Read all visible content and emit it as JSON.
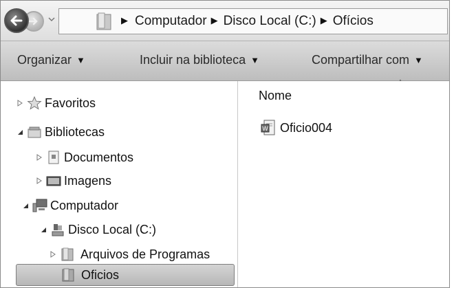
{
  "address_bar": {
    "breadcrumbs": [
      "Computador",
      "Disco Local (C:)",
      "Ofícios"
    ]
  },
  "toolbar": {
    "organize_label": "Organizar",
    "include_label": "Incluir na biblioteca",
    "share_label": "Compartilhar com"
  },
  "nav_tree": {
    "favorites": "Favoritos",
    "libraries": "Bibliotecas",
    "documents": "Documentos",
    "images": "Imagens",
    "computer": "Computador",
    "local_disk": "Disco Local (C:)",
    "program_files": "Arquivos de Programas",
    "oficios": "Oficios"
  },
  "content": {
    "column_name": "Nome",
    "files": [
      {
        "name": "Oficio004",
        "icon": "word-document-icon"
      }
    ]
  },
  "icons": {
    "back": "back-arrow-icon",
    "forward": "forward-arrow-icon",
    "favorites": "star-icon",
    "libraries": "library-icon",
    "documents": "document-icon",
    "images": "image-library-icon",
    "computer": "computer-icon",
    "disk": "hard-disk-icon",
    "folder": "folder-icon"
  }
}
